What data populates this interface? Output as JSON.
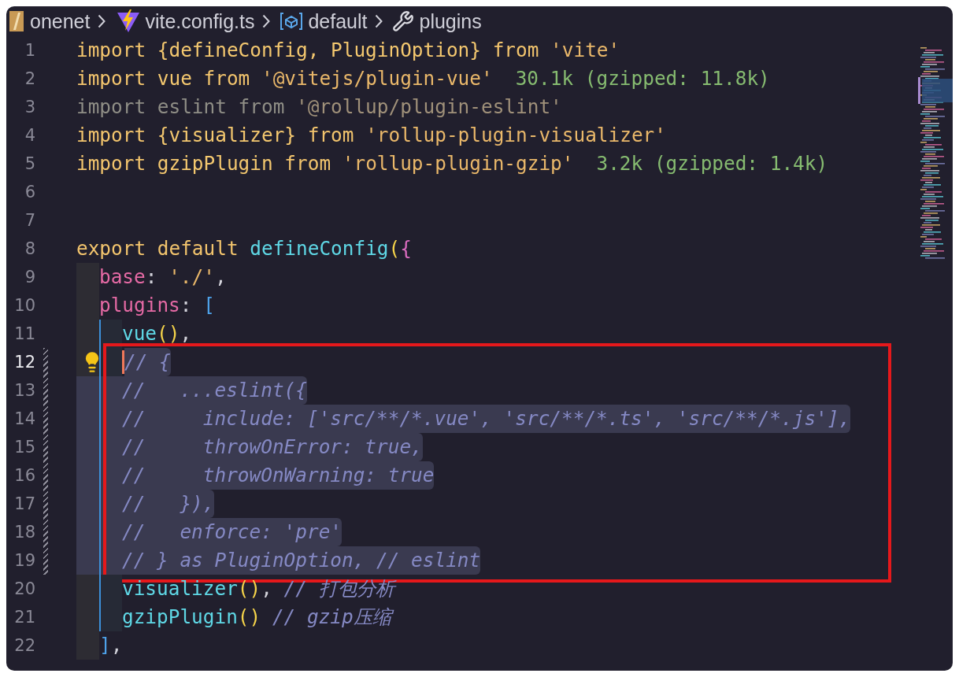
{
  "breadcrumb": [
    {
      "kind": "folder",
      "label": "onenet"
    },
    {
      "kind": "vite",
      "label": "vite.config.ts"
    },
    {
      "kind": "symbol",
      "label": "default"
    },
    {
      "kind": "wrench",
      "label": "plugins"
    }
  ],
  "blocks": [
    {
      "annotated": false,
      "lines": [
        {
          "number": "1",
          "current": false,
          "selected": false,
          "changed": false,
          "lightbulb": false,
          "tokens": [
            {
              "kind": "kw",
              "text": "import "
            },
            {
              "kind": "ident",
              "text": "{defineConfig, PluginOption} "
            },
            {
              "kind": "kw",
              "text": "from "
            },
            {
              "kind": "str",
              "text": "'vite'"
            }
          ]
        },
        {
          "number": "2",
          "current": false,
          "selected": false,
          "changed": false,
          "lightbulb": false,
          "tokens": [
            {
              "kind": "kw",
              "text": "import "
            },
            {
              "kind": "ident",
              "text": "vue "
            },
            {
              "kind": "kw",
              "text": "from "
            },
            {
              "kind": "str",
              "text": "'@vitejs/plugin-vue'"
            },
            {
              "kind": "hint",
              "text": "30.1k (gzipped: 11.8k)"
            }
          ]
        },
        {
          "number": "3",
          "current": false,
          "selected": false,
          "changed": false,
          "lightbulb": false,
          "tokens": [
            {
              "kind": "dim",
              "text": "import eslint from "
            },
            {
              "kind": "dimstr",
              "text": "'@rollup/plugin-eslint'"
            }
          ]
        },
        {
          "number": "4",
          "current": false,
          "selected": false,
          "changed": false,
          "lightbulb": false,
          "tokens": [
            {
              "kind": "kw",
              "text": "import "
            },
            {
              "kind": "ident",
              "text": "{visualizer} "
            },
            {
              "kind": "kw",
              "text": "from "
            },
            {
              "kind": "str",
              "text": "'rollup-plugin-visualizer'"
            }
          ]
        },
        {
          "number": "5",
          "current": false,
          "selected": false,
          "changed": false,
          "lightbulb": false,
          "tokens": [
            {
              "kind": "kw",
              "text": "import "
            },
            {
              "kind": "ident",
              "text": "gzipPlugin "
            },
            {
              "kind": "kw",
              "text": "from "
            },
            {
              "kind": "str",
              "text": "'rollup-plugin-gzip'"
            },
            {
              "kind": "hint",
              "text": "3.2k (gzipped: 1.4k)"
            }
          ]
        },
        {
          "number": "6",
          "current": false,
          "selected": false,
          "changed": false,
          "lightbulb": false
        },
        {
          "number": "7",
          "current": false,
          "selected": false,
          "changed": false,
          "lightbulb": false
        },
        {
          "number": "8",
          "current": false,
          "selected": false,
          "changed": false,
          "lightbulb": false,
          "tokens": [
            {
              "kind": "kw",
              "text": "export default "
            },
            {
              "kind": "func",
              "text": "defineConfig"
            },
            {
              "kind": "paren",
              "text": "("
            },
            {
              "kind": "brace",
              "text": "{"
            }
          ]
        },
        {
          "number": "9",
          "current": false,
          "selected": false,
          "changed": false,
          "lightbulb": false,
          "guides": [
            {
              "active": false
            }
          ],
          "tokens": [
            {
              "kind": "prop",
              "text": "base"
            },
            {
              "kind": "punct",
              "text": ": "
            },
            {
              "kind": "str",
              "text": "'./'"
            },
            {
              "kind": "punct",
              "text": ","
            }
          ]
        },
        {
          "number": "10",
          "current": false,
          "selected": false,
          "changed": false,
          "lightbulb": false,
          "guides": [
            {
              "active": false
            }
          ],
          "tokens": [
            {
              "kind": "prop",
              "text": "plugins"
            },
            {
              "kind": "punct",
              "text": ": "
            },
            {
              "kind": "bracket",
              "text": "["
            }
          ]
        },
        {
          "number": "11",
          "current": false,
          "selected": false,
          "changed": false,
          "lightbulb": false,
          "guides": [
            {
              "active": false
            },
            {
              "active": true
            }
          ],
          "tokens": [
            {
              "kind": "func",
              "text": "vue"
            },
            {
              "kind": "paren",
              "text": "()"
            },
            {
              "kind": "punct",
              "text": ","
            }
          ]
        }
      ]
    },
    {
      "annotated": true,
      "lines": [
        {
          "number": "12",
          "current": true,
          "selected": true,
          "changed": true,
          "lightbulb": true,
          "guides": [
            {
              "active": false
            },
            {
              "active": true
            }
          ],
          "tokens": [
            {
              "kind": "comment",
              "text": "// {"
            }
          ]
        },
        {
          "number": "13",
          "current": false,
          "selected": true,
          "changed": true,
          "lightbulb": false,
          "guides": [
            {
              "active": false
            },
            {
              "active": true
            }
          ],
          "tokens": [
            {
              "kind": "comment",
              "text": "//   ...eslint({"
            }
          ]
        },
        {
          "number": "14",
          "current": false,
          "selected": true,
          "changed": true,
          "lightbulb": false,
          "guides": [
            {
              "active": false
            },
            {
              "active": true
            }
          ],
          "tokens": [
            {
              "kind": "comment",
              "text": "//     include: ['src/**/*.vue', 'src/**/*.ts', 'src/**/*.js'],"
            }
          ]
        },
        {
          "number": "15",
          "current": false,
          "selected": true,
          "changed": true,
          "lightbulb": false,
          "guides": [
            {
              "active": false
            },
            {
              "active": true
            }
          ],
          "tokens": [
            {
              "kind": "comment",
              "text": "//     throwOnError: true,"
            }
          ]
        },
        {
          "number": "16",
          "current": false,
          "selected": true,
          "changed": true,
          "lightbulb": false,
          "guides": [
            {
              "active": false
            },
            {
              "active": true
            }
          ],
          "tokens": [
            {
              "kind": "comment",
              "text": "//     throwOnWarning: true"
            }
          ]
        },
        {
          "number": "17",
          "current": false,
          "selected": true,
          "changed": true,
          "lightbulb": false,
          "guides": [
            {
              "active": false
            },
            {
              "active": true
            }
          ],
          "tokens": [
            {
              "kind": "comment",
              "text": "//   }),"
            }
          ]
        },
        {
          "number": "18",
          "current": false,
          "selected": true,
          "changed": true,
          "lightbulb": false,
          "guides": [
            {
              "active": false
            },
            {
              "active": true
            }
          ],
          "tokens": [
            {
              "kind": "comment",
              "text": "//   enforce: 'pre'"
            }
          ]
        },
        {
          "number": "19",
          "current": false,
          "selected": true,
          "changed": true,
          "lightbulb": false,
          "guides": [
            {
              "active": false
            },
            {
              "active": true
            }
          ],
          "tokens": [
            {
              "kind": "comment",
              "text": "// } as PluginOption, // eslint"
            }
          ]
        }
      ]
    },
    {
      "annotated": false,
      "lines": [
        {
          "number": "20",
          "current": false,
          "selected": false,
          "changed": false,
          "lightbulb": false,
          "guides": [
            {
              "active": false
            },
            {
              "active": true
            }
          ],
          "tokens": [
            {
              "kind": "func",
              "text": "visualizer"
            },
            {
              "kind": "paren",
              "text": "()"
            },
            {
              "kind": "punct",
              "text": ", "
            },
            {
              "kind": "comment",
              "text": "// 打包分析"
            }
          ]
        },
        {
          "number": "21",
          "current": false,
          "selected": false,
          "changed": false,
          "lightbulb": false,
          "guides": [
            {
              "active": false
            },
            {
              "active": true
            }
          ],
          "tokens": [
            {
              "kind": "func",
              "text": "gzipPlugin"
            },
            {
              "kind": "paren",
              "text": "() "
            },
            {
              "kind": "comment",
              "text": "// gzip压缩"
            }
          ]
        },
        {
          "number": "22",
          "current": false,
          "selected": false,
          "changed": false,
          "lightbulb": false,
          "guides": [
            {
              "active": false
            }
          ],
          "tokens": [
            {
              "kind": "bracket",
              "text": "]"
            },
            {
              "kind": "punct",
              "text": ","
            }
          ]
        }
      ]
    }
  ]
}
